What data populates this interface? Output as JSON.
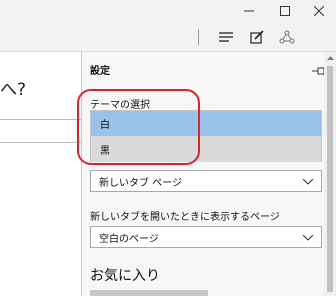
{
  "window": {
    "controls": [
      "minimize-icon",
      "maximize-icon",
      "close-icon"
    ]
  },
  "toolbar": {
    "icons": [
      "hub-icon",
      "note-icon",
      "share-icon"
    ]
  },
  "page": {
    "partial_text": "へ?"
  },
  "settings": {
    "title": "設定",
    "theme_label": "テーマの選択",
    "theme_options": [
      "白",
      "黒"
    ],
    "theme_selected": "白",
    "open_with_value": "新しいタブ ページ",
    "new_tab_label": "新しいタブを開いたときに表示するページ",
    "new_tab_value": "空白のページ",
    "favorites_heading": "お気に入り"
  },
  "colors": {
    "selected_option": "#99c2ea",
    "annotation": "#d3282b"
  }
}
